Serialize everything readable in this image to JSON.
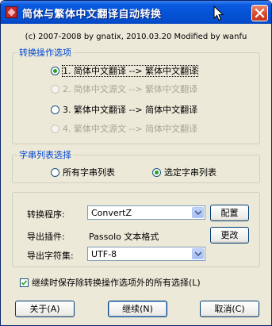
{
  "window": {
    "title": "简体与繁体中文翻译自动转换",
    "close_icon": "close-icon"
  },
  "copyright": "(c) 2007-2008 by gnatix, 2010.03.20 Modified by wanfu",
  "conversion_group": {
    "legend": "转换操作选项",
    "options": [
      {
        "label": "1. 简体中文翻译 --> 繁体中文翻译",
        "checked": true,
        "enabled": true
      },
      {
        "label": "2. 简体中文源文 --> 繁体中文翻译",
        "checked": false,
        "enabled": false
      },
      {
        "label": "3. 繁体中文翻译 --> 简体中文翻译",
        "checked": false,
        "enabled": true
      },
      {
        "label": "4. 繁体中文源文 --> 简体中文翻译",
        "checked": false,
        "enabled": false
      }
    ]
  },
  "string_list_group": {
    "legend": "字串列表选择",
    "options": [
      {
        "label": "所有字串列表",
        "checked": false
      },
      {
        "label": "选定字串列表",
        "checked": true
      }
    ]
  },
  "settings": {
    "converter_label": "转换程序:",
    "converter_value": "ConvertZ",
    "config_button": "配置",
    "plugin_label": "导出插件:",
    "plugin_value": "Passolo 文本格式",
    "change_button": "更改",
    "charset_label": "导出字符集:",
    "charset_value": "UTF-8"
  },
  "keep_selection": {
    "label": "继续时保存除转换操作选项外的所有选择(L)",
    "checked": true
  },
  "buttons": {
    "about": "关于(A)",
    "continue": "继续(N)",
    "cancel": "取消(C)"
  }
}
